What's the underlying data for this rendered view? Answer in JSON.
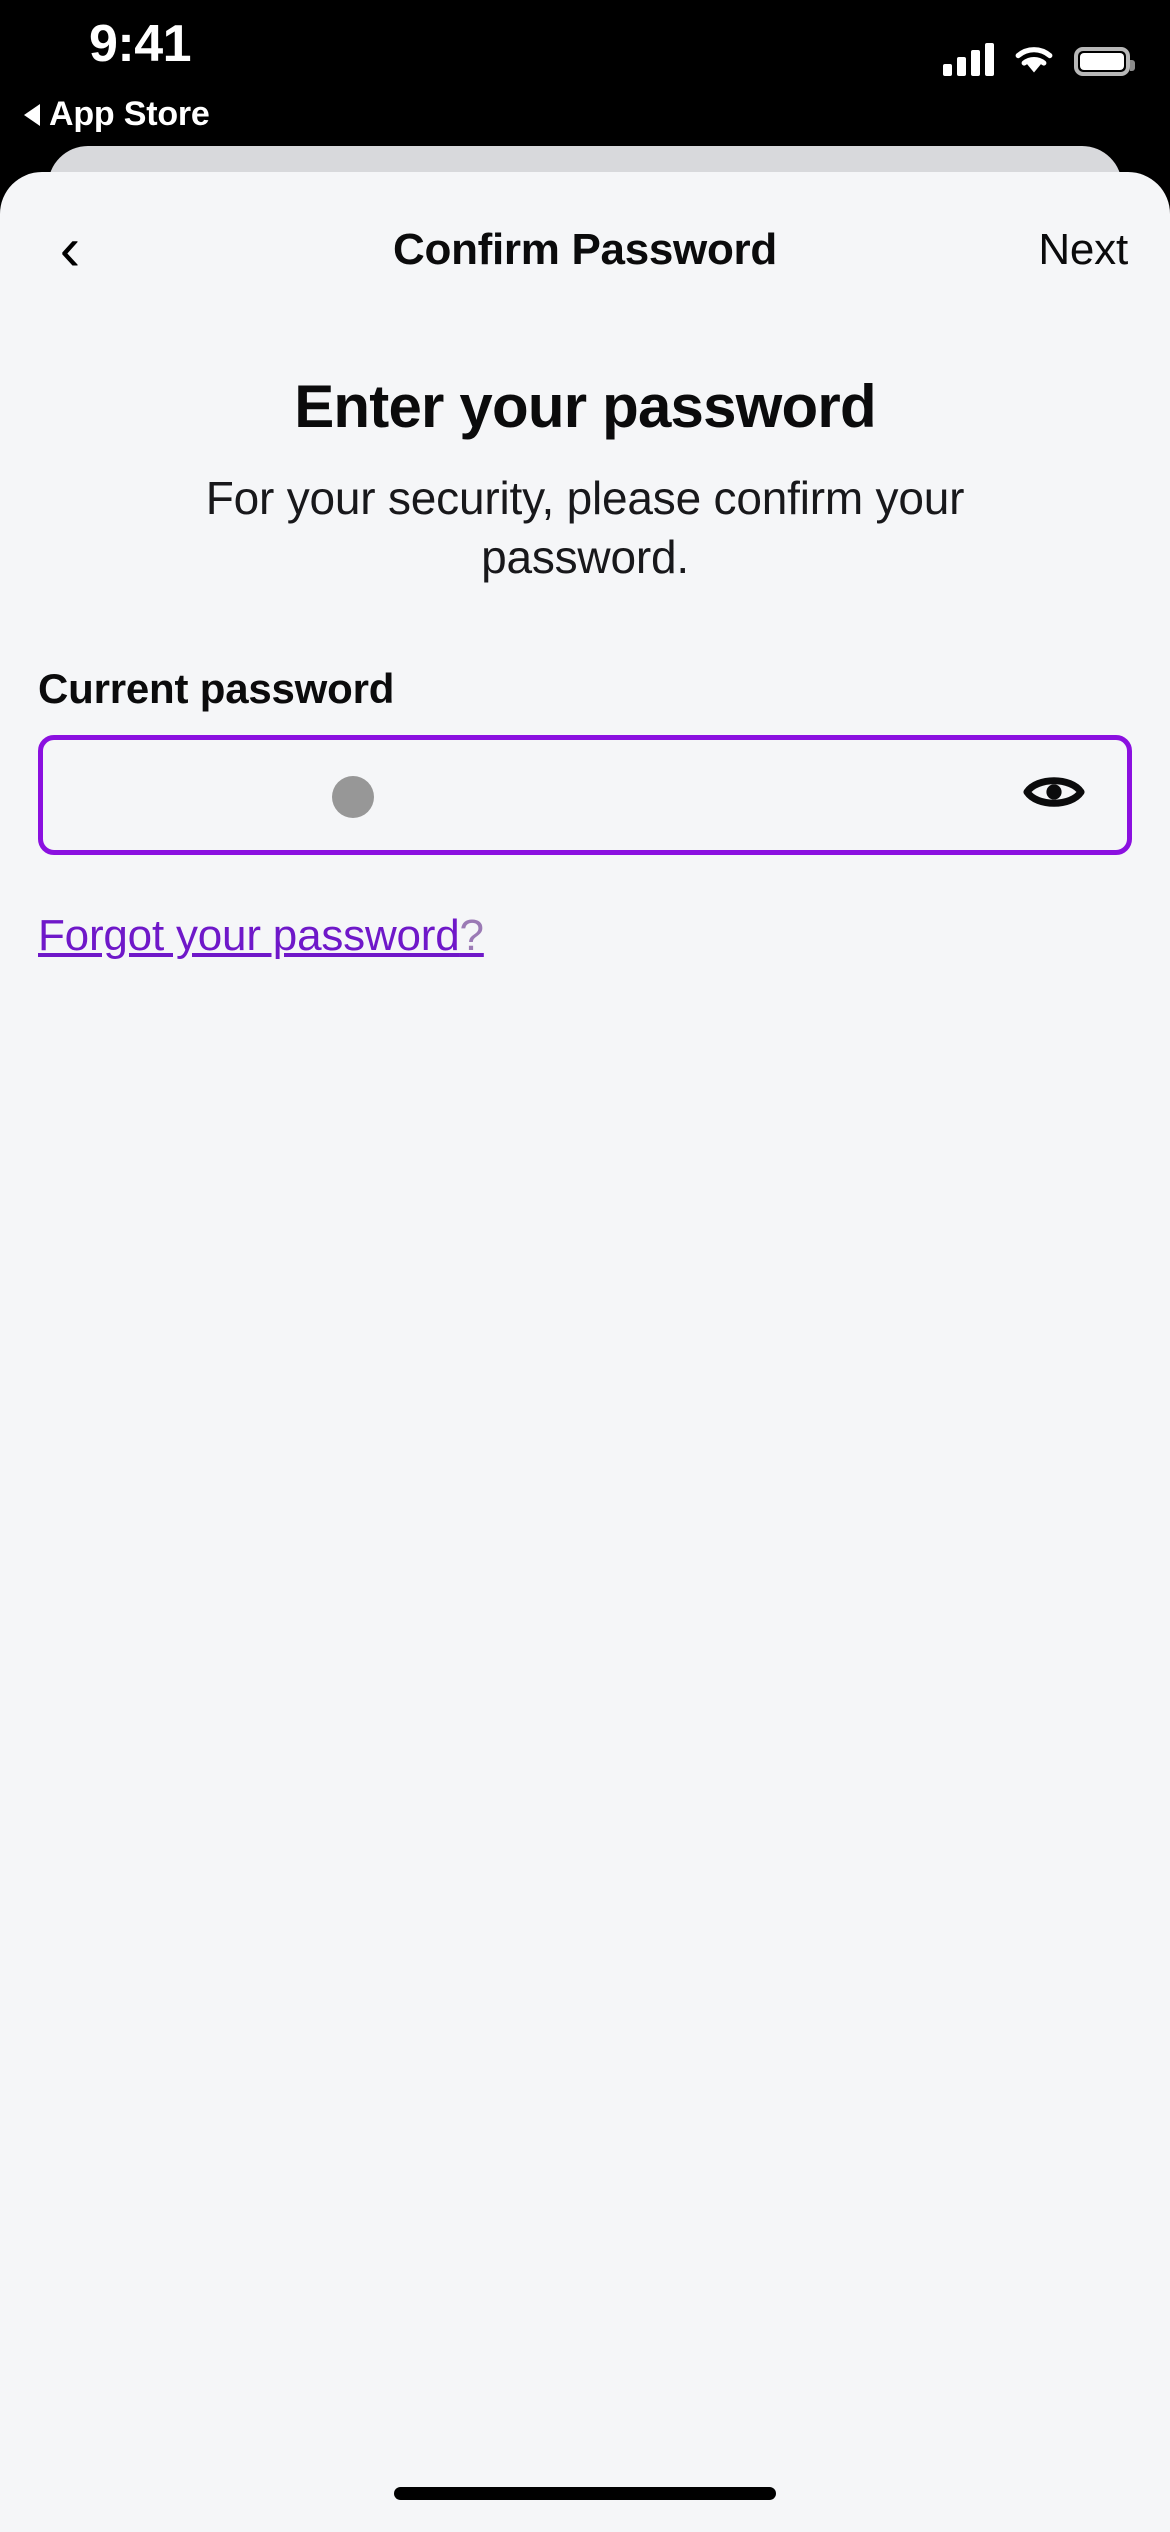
{
  "status_bar": {
    "time": "9:41",
    "back_app_label": "App Store",
    "back_triangle_icon": "triangle-left-icon",
    "cellular_icon": "cellular-signal-icon",
    "wifi_icon": "wifi-icon",
    "battery_icon": "battery-full-icon"
  },
  "nav_bar": {
    "back_chevron": "‹",
    "back_icon_name": "chevron-left-icon",
    "title": "Confirm Password",
    "next_label": "Next"
  },
  "content": {
    "headline": "Enter your password",
    "subtitle": "For your security, please confirm your password.",
    "field_label": "Current password",
    "password_value": "",
    "password_placeholder": "",
    "visibility_toggle_icon": "eye-icon",
    "forgot_link_text": "Forgot your password",
    "forgot_link_suffix": "?"
  },
  "colors": {
    "accent_purple": "#8b10e0",
    "link_purple": "#6f18c9",
    "background": "#f5f6f8",
    "sheet_behind": "#d8d9dc",
    "status_bar_bg": "#000000",
    "touch_indicator": "#979797"
  },
  "home_indicator": {
    "label": "home-indicator"
  }
}
